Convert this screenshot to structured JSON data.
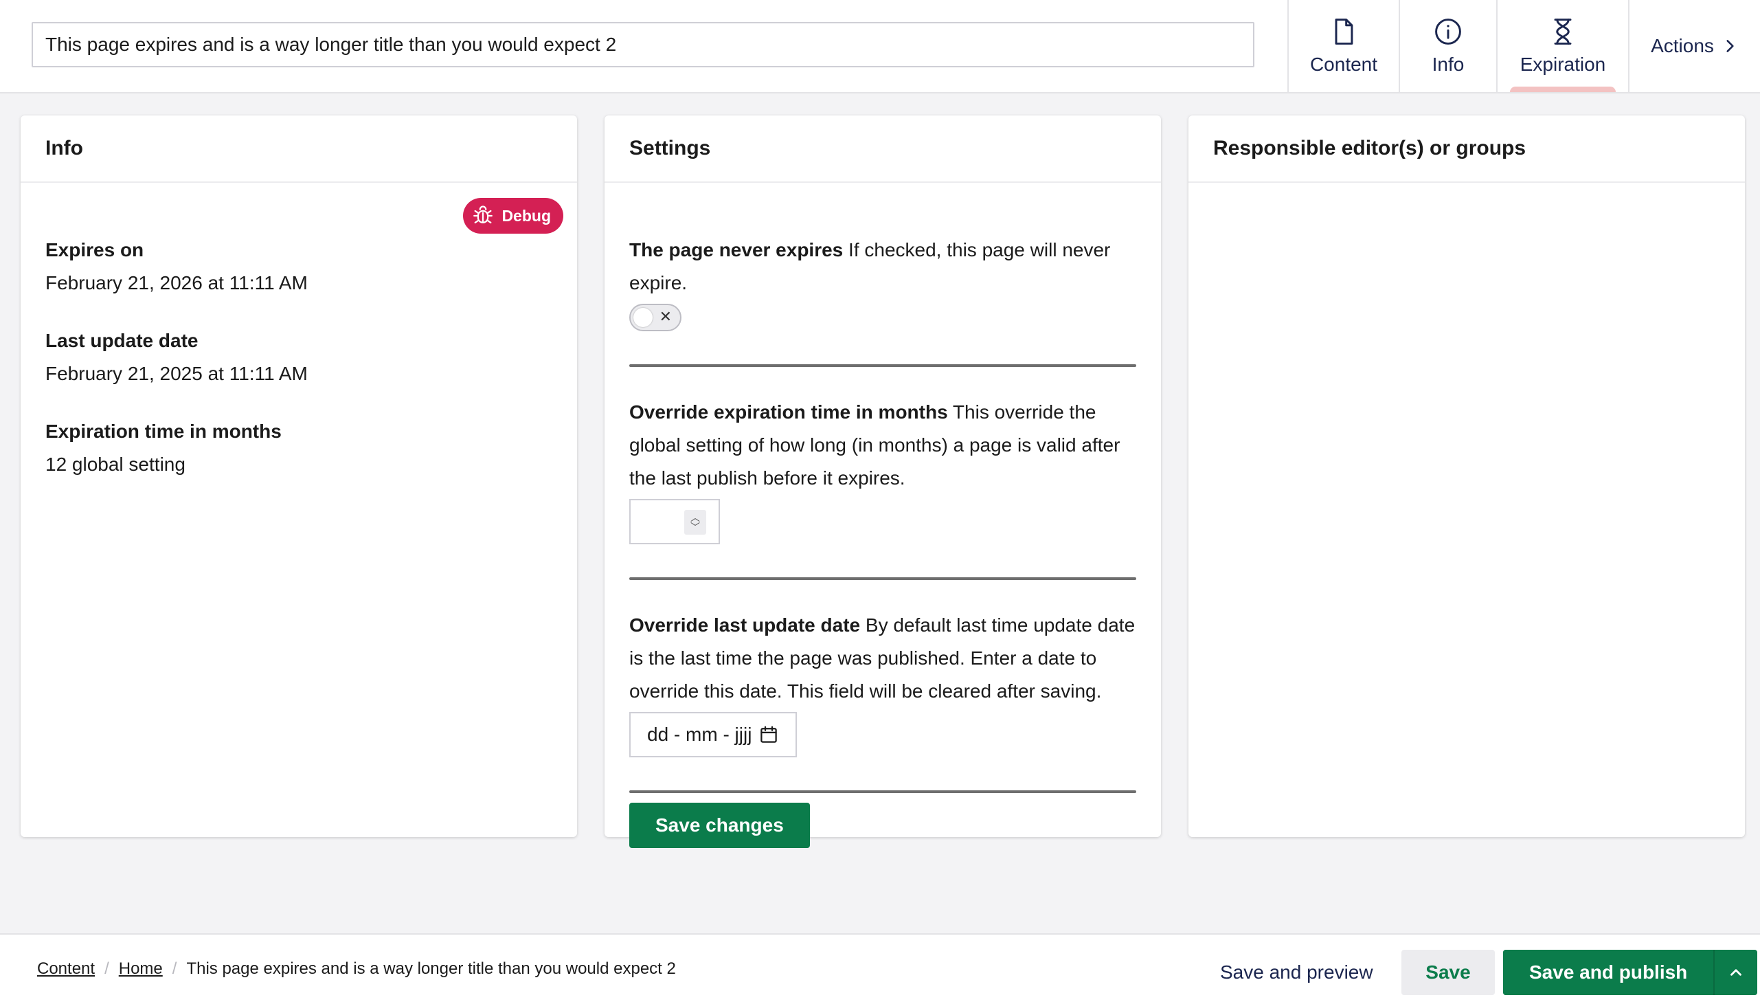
{
  "header": {
    "page_title_value": "This page expires and is a way longer title than you would expect 2",
    "tabs": [
      {
        "label": "Content",
        "icon": "document-icon"
      },
      {
        "label": "Info",
        "icon": "info-icon"
      },
      {
        "label": "Expiration",
        "icon": "hourglass-icon",
        "active": true
      }
    ],
    "actions_label": "Actions"
  },
  "info_panel": {
    "title": "Info",
    "debug_label": "Debug",
    "fields": [
      {
        "label": "Expires on",
        "value": "February 21, 2026 at 11:11 AM"
      },
      {
        "label": "Last update date",
        "value": "February 21, 2025 at 11:11 AM"
      },
      {
        "label": "Expiration time in months",
        "value": "12 global setting"
      }
    ]
  },
  "settings_panel": {
    "title": "Settings",
    "never_expires": {
      "label": "The page never expires",
      "description": " If checked, this page will never expire.",
      "checked": false
    },
    "override_months": {
      "label": "Override expiration time in months",
      "description": " This override the global setting of how long (in months) a page is valid after the last publish before it expires.",
      "value": ""
    },
    "override_date": {
      "label": "Override last update date",
      "description": " By default last time update date is the last time the page was published. Enter a date to override this date. This field will be cleared after saving.",
      "placeholder": "dd - mm - jjjj"
    },
    "save_label": "Save changes"
  },
  "editors_panel": {
    "title": "Responsible editor(s) or groups"
  },
  "footer": {
    "breadcrumb": {
      "items": [
        "Content",
        "Home"
      ],
      "current": "This page expires and is a way longer title than you would expect 2"
    },
    "save_preview_label": "Save and preview",
    "save_label": "Save",
    "save_publish_label": "Save and publish"
  },
  "colors": {
    "accent_green": "#0b7c4b",
    "debug_red": "#d42054",
    "text_navy": "#1b264f",
    "active_tab_indicator": "#f3c2c2"
  }
}
